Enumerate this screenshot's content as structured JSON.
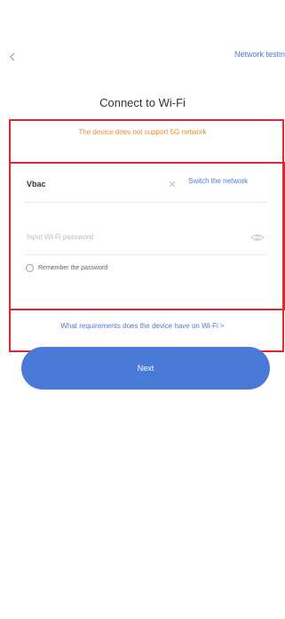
{
  "header": {
    "back_icon": "chevron-left-icon",
    "network_testing_label": "Network testin"
  },
  "title": "Connect to Wi-Fi",
  "warning": "The device does not support 5G network",
  "wifi": {
    "ssid": "Vbac",
    "clear_icon": "close-icon",
    "switch_label": "Switch the network"
  },
  "password": {
    "placeholder": "Input Wi-Fi password",
    "value": "",
    "visibility_icon": "eye-icon"
  },
  "remember": {
    "label": "Remember the password",
    "checked": false
  },
  "requirements_link": "What requirements does the device have on Wi-Fi >",
  "next_button": "Next",
  "colors": {
    "accent": "#4a7ad8",
    "warning": "#f08a2a",
    "annotation": "#e0262f"
  }
}
